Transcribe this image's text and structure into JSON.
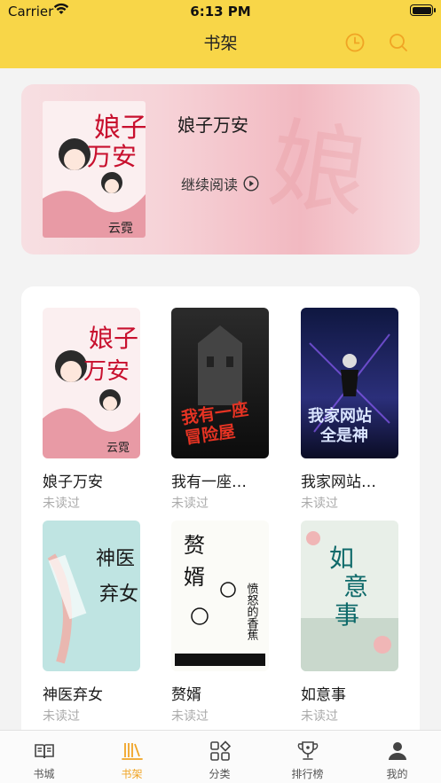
{
  "status_bar": {
    "carrier": "Carrier",
    "time": "6:13 PM"
  },
  "header": {
    "title": "书架",
    "icons": [
      "clock-icon",
      "search-icon"
    ],
    "accent": "#f8d648"
  },
  "recent": {
    "title": "娘子万安",
    "continue_label": "继续阅读"
  },
  "shelf": {
    "books": [
      {
        "title": "娘子万安",
        "status": "未读过",
        "cover_text": "娘子万安"
      },
      {
        "title": "我有一座…",
        "status": "未读过",
        "cover_text": "我有一座冒险屋"
      },
      {
        "title": "我家网站…",
        "status": "未读过",
        "cover_text": "我家网站全是神"
      },
      {
        "title": "神医弃女",
        "status": "未读过",
        "cover_text": "神医弃女"
      },
      {
        "title": "赘婿",
        "status": "未读过",
        "cover_text": "赘婿"
      },
      {
        "title": "如意事",
        "status": "未读过",
        "cover_text": "如意事"
      }
    ]
  },
  "tabbar": {
    "items": [
      {
        "label": "书城",
        "icon": "book-open-icon"
      },
      {
        "label": "书架",
        "icon": "bookshelf-icon",
        "active": true
      },
      {
        "label": "分类",
        "icon": "category-icon"
      },
      {
        "label": "排行榜",
        "icon": "trophy-icon"
      },
      {
        "label": "我的",
        "icon": "user-icon"
      }
    ],
    "active_color": "#f0a424"
  }
}
